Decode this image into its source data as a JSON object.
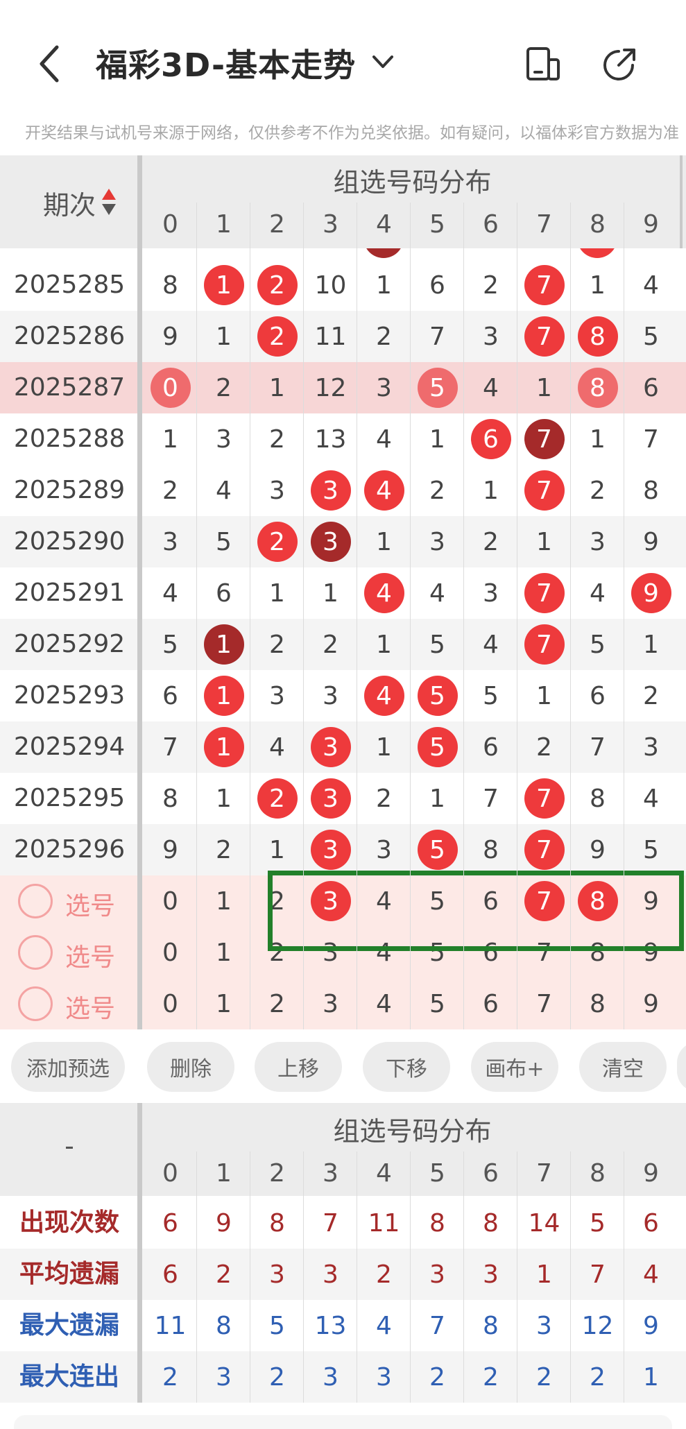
{
  "header": {
    "title": "福彩3D-基本走势",
    "notice": "开奖结果与试机号来源于网络，仅供参考不作为兑奖依据。如有疑问，以福体彩官方数据为准"
  },
  "table": {
    "issue_header": "期次",
    "group_header": "组选号码分布",
    "digits": [
      "0",
      "1",
      "2",
      "3",
      "4",
      "5",
      "6",
      "7",
      "8",
      "9"
    ],
    "rows": [
      {
        "issue": "2025285",
        "style": "white",
        "cells": [
          {
            "v": "8"
          },
          {
            "v": "1",
            "b": "red"
          },
          {
            "v": "2",
            "b": "red"
          },
          {
            "v": "10"
          },
          {
            "v": "1"
          },
          {
            "v": "6"
          },
          {
            "v": "2"
          },
          {
            "v": "7",
            "b": "red"
          },
          {
            "v": "1"
          },
          {
            "v": "4"
          }
        ]
      },
      {
        "issue": "2025286",
        "style": "alt",
        "cells": [
          {
            "v": "9"
          },
          {
            "v": "1"
          },
          {
            "v": "2",
            "b": "red"
          },
          {
            "v": "11"
          },
          {
            "v": "2"
          },
          {
            "v": "7"
          },
          {
            "v": "3"
          },
          {
            "v": "7",
            "b": "red"
          },
          {
            "v": "8",
            "b": "red"
          },
          {
            "v": "5"
          }
        ]
      },
      {
        "issue": "2025287",
        "style": "hl",
        "cells": [
          {
            "v": "0",
            "b": "faded"
          },
          {
            "v": "2"
          },
          {
            "v": "1"
          },
          {
            "v": "12"
          },
          {
            "v": "3"
          },
          {
            "v": "5",
            "b": "faded"
          },
          {
            "v": "4"
          },
          {
            "v": "1"
          },
          {
            "v": "8",
            "b": "faded"
          },
          {
            "v": "6"
          }
        ]
      },
      {
        "issue": "2025288",
        "style": "white",
        "cells": [
          {
            "v": "1"
          },
          {
            "v": "3"
          },
          {
            "v": "2"
          },
          {
            "v": "13"
          },
          {
            "v": "4"
          },
          {
            "v": "1"
          },
          {
            "v": "6",
            "b": "red"
          },
          {
            "v": "7",
            "b": "dark"
          },
          {
            "v": "1"
          },
          {
            "v": "7"
          }
        ]
      },
      {
        "issue": "2025289",
        "style": "white",
        "cells": [
          {
            "v": "2"
          },
          {
            "v": "4"
          },
          {
            "v": "3"
          },
          {
            "v": "3",
            "b": "red"
          },
          {
            "v": "4",
            "b": "red"
          },
          {
            "v": "2"
          },
          {
            "v": "1"
          },
          {
            "v": "7",
            "b": "red"
          },
          {
            "v": "2"
          },
          {
            "v": "8"
          }
        ]
      },
      {
        "issue": "2025290",
        "style": "alt",
        "cells": [
          {
            "v": "3"
          },
          {
            "v": "5"
          },
          {
            "v": "2",
            "b": "red"
          },
          {
            "v": "3",
            "b": "dark"
          },
          {
            "v": "1"
          },
          {
            "v": "3"
          },
          {
            "v": "2"
          },
          {
            "v": "1"
          },
          {
            "v": "3"
          },
          {
            "v": "9"
          }
        ]
      },
      {
        "issue": "2025291",
        "style": "white",
        "cells": [
          {
            "v": "4"
          },
          {
            "v": "6"
          },
          {
            "v": "1"
          },
          {
            "v": "1"
          },
          {
            "v": "4",
            "b": "red"
          },
          {
            "v": "4"
          },
          {
            "v": "3"
          },
          {
            "v": "7",
            "b": "red"
          },
          {
            "v": "4"
          },
          {
            "v": "9",
            "b": "red"
          }
        ]
      },
      {
        "issue": "2025292",
        "style": "alt",
        "cells": [
          {
            "v": "5"
          },
          {
            "v": "1",
            "b": "dark"
          },
          {
            "v": "2"
          },
          {
            "v": "2"
          },
          {
            "v": "1"
          },
          {
            "v": "5"
          },
          {
            "v": "4"
          },
          {
            "v": "7",
            "b": "red"
          },
          {
            "v": "5"
          },
          {
            "v": "1"
          }
        ]
      },
      {
        "issue": "2025293",
        "style": "white",
        "cells": [
          {
            "v": "6"
          },
          {
            "v": "1",
            "b": "red"
          },
          {
            "v": "3"
          },
          {
            "v": "3"
          },
          {
            "v": "4",
            "b": "red"
          },
          {
            "v": "5",
            "b": "red"
          },
          {
            "v": "5"
          },
          {
            "v": "1"
          },
          {
            "v": "6"
          },
          {
            "v": "2"
          }
        ]
      },
      {
        "issue": "2025294",
        "style": "alt",
        "cells": [
          {
            "v": "7"
          },
          {
            "v": "1",
            "b": "red"
          },
          {
            "v": "4"
          },
          {
            "v": "3",
            "b": "red"
          },
          {
            "v": "1"
          },
          {
            "v": "5",
            "b": "red"
          },
          {
            "v": "6"
          },
          {
            "v": "2"
          },
          {
            "v": "7"
          },
          {
            "v": "3"
          }
        ]
      },
      {
        "issue": "2025295",
        "style": "white",
        "cells": [
          {
            "v": "8"
          },
          {
            "v": "1"
          },
          {
            "v": "2",
            "b": "red"
          },
          {
            "v": "3",
            "b": "red"
          },
          {
            "v": "2"
          },
          {
            "v": "1"
          },
          {
            "v": "7"
          },
          {
            "v": "7",
            "b": "red"
          },
          {
            "v": "8"
          },
          {
            "v": "4"
          }
        ]
      },
      {
        "issue": "2025296",
        "style": "alt",
        "cells": [
          {
            "v": "9"
          },
          {
            "v": "2"
          },
          {
            "v": "1"
          },
          {
            "v": "3",
            "b": "red"
          },
          {
            "v": "3"
          },
          {
            "v": "5",
            "b": "red"
          },
          {
            "v": "8"
          },
          {
            "v": "7",
            "b": "red"
          },
          {
            "v": "9"
          },
          {
            "v": "5"
          }
        ]
      }
    ],
    "pick_rows": [
      {
        "label": "选号",
        "cells": [
          {
            "v": "0"
          },
          {
            "v": "1"
          },
          {
            "v": "2"
          },
          {
            "v": "3",
            "b": "red"
          },
          {
            "v": "4"
          },
          {
            "v": "5"
          },
          {
            "v": "6"
          },
          {
            "v": "7",
            "b": "red"
          },
          {
            "v": "8",
            "b": "red"
          },
          {
            "v": "9"
          }
        ]
      },
      {
        "label": "选号",
        "cells": [
          {
            "v": "0"
          },
          {
            "v": "1"
          },
          {
            "v": "2"
          },
          {
            "v": "3"
          },
          {
            "v": "4"
          },
          {
            "v": "5"
          },
          {
            "v": "6"
          },
          {
            "v": "7"
          },
          {
            "v": "8"
          },
          {
            "v": "9"
          }
        ]
      },
      {
        "label": "选号",
        "cells": [
          {
            "v": "0"
          },
          {
            "v": "1"
          },
          {
            "v": "2"
          },
          {
            "v": "3"
          },
          {
            "v": "4"
          },
          {
            "v": "5"
          },
          {
            "v": "6"
          },
          {
            "v": "7"
          },
          {
            "v": "8"
          },
          {
            "v": "9"
          }
        ]
      }
    ]
  },
  "buttons": [
    "添加预选",
    "删除",
    "上移",
    "下移",
    "画布+",
    "清空"
  ],
  "stats": {
    "corner": "-",
    "group_header": "组选号码分布",
    "rows": [
      {
        "label": "出现次数",
        "color": "#a52a2a",
        "values": [
          "6",
          "9",
          "8",
          "7",
          "11",
          "8",
          "8",
          "14",
          "5",
          "6"
        ]
      },
      {
        "label": "平均遗漏",
        "color": "#a52a2a",
        "values": [
          "6",
          "2",
          "3",
          "3",
          "2",
          "3",
          "3",
          "1",
          "7",
          "4"
        ]
      },
      {
        "label": "最大遗漏",
        "color": "#2f5fb3",
        "values": [
          "11",
          "8",
          "5",
          "13",
          "4",
          "7",
          "8",
          "3",
          "12",
          "9"
        ]
      },
      {
        "label": "最大连出",
        "color": "#2f5fb3",
        "values": [
          "2",
          "3",
          "2",
          "3",
          "3",
          "2",
          "2",
          "2",
          "2",
          "1"
        ]
      }
    ]
  }
}
